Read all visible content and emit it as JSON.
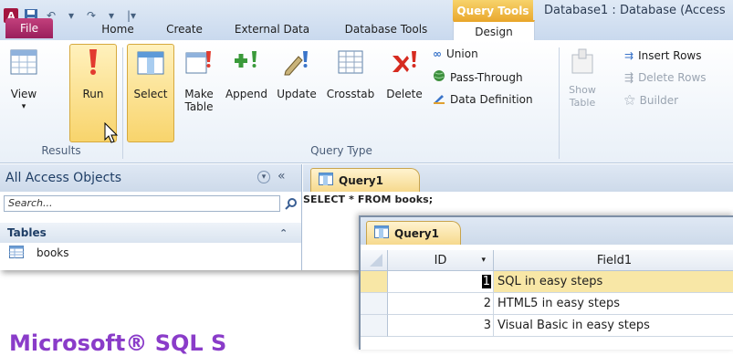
{
  "window": {
    "title": "Database1 : Database (Access",
    "context_tab_group": "Query Tools"
  },
  "ribbon_tabs": [
    "File",
    "Home",
    "Create",
    "External Data",
    "Database Tools",
    "Design"
  ],
  "ribbon": {
    "results_group": {
      "label": "Results",
      "view": "View",
      "run": "Run"
    },
    "query_type_group": {
      "label": "Query Type",
      "select": "Select",
      "make_table_1": "Make",
      "make_table_2": "Table",
      "append": "Append",
      "update": "Update",
      "crosstab": "Crosstab",
      "delete": "Delete",
      "union": "Union",
      "pass_through": "Pass-Through",
      "data_definition": "Data Definition"
    },
    "setup_group": {
      "show_table_1": "Show",
      "show_table_2": "Table",
      "insert_rows": "Insert Rows",
      "delete_rows": "Delete Rows",
      "builder": "Builder"
    }
  },
  "nav_pane": {
    "header": "All Access Objects",
    "search_placeholder": "Search...",
    "section": "Tables",
    "items": [
      "books"
    ]
  },
  "query": {
    "tab_label": "Query1",
    "sql": "SELECT * FROM books;"
  },
  "datasheet": {
    "tab_label": "Query1",
    "columns": [
      "ID",
      "Field1"
    ],
    "rows": [
      {
        "id": "1",
        "field1": "SQL in easy steps"
      },
      {
        "id": "2",
        "field1": "HTML5 in easy steps"
      },
      {
        "id": "3",
        "field1": "Visual Basic in easy steps"
      }
    ]
  },
  "headline": "Microsoft® SQL S",
  "colors": {
    "accent": "#e9a72c",
    "file_tab": "#b1306e",
    "headline": "#8a3cc9"
  }
}
